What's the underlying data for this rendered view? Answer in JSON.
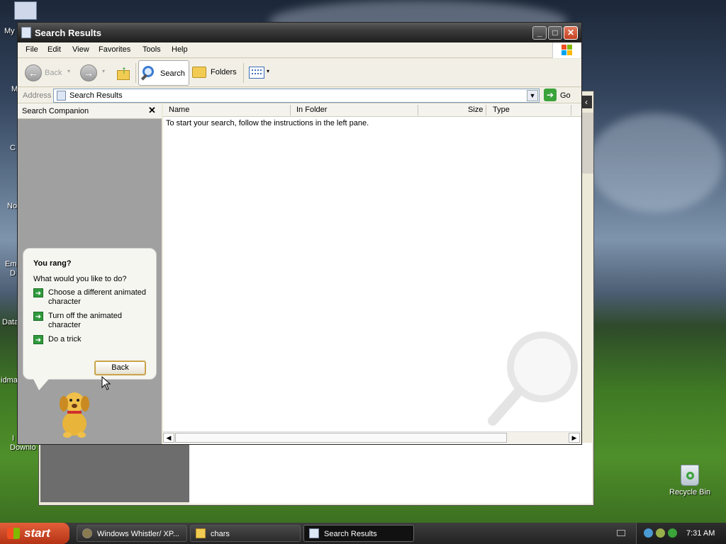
{
  "desktop": {
    "icons": [
      {
        "label": "My"
      },
      {
        "label": "M"
      },
      {
        "label": "C"
      },
      {
        "label": "No"
      },
      {
        "label": "Em"
      },
      {
        "label": "D"
      },
      {
        "label": "Data"
      },
      {
        "label": "idma"
      },
      {
        "label": "I"
      },
      {
        "label": "Downlo"
      }
    ],
    "recycle_bin": "Recycle Bin"
  },
  "window": {
    "title": "Search Results",
    "buttons": {
      "minimize": "_",
      "maximize": "□",
      "close": "✕"
    }
  },
  "menu": {
    "items": [
      "File",
      "Edit",
      "View",
      "Favorites",
      "Tools",
      "Help"
    ]
  },
  "toolbar": {
    "back": "Back",
    "search": "Search",
    "folders": "Folders"
  },
  "address": {
    "label": "Address",
    "value": "Search Results",
    "go": "Go"
  },
  "left_pane": {
    "title": "Search Companion",
    "close": "✕"
  },
  "bubble": {
    "title": "You rang?",
    "question": "What would you like to do?",
    "options": [
      {
        "line1": "Choose a different animated",
        "line2": "character"
      },
      {
        "line1": "Turn off the animated",
        "line2": "character"
      },
      {
        "line1": "Do a trick",
        "line2": ""
      }
    ],
    "back_button": "Back"
  },
  "results": {
    "columns": [
      "Name",
      "In Folder",
      "Size",
      "Type"
    ],
    "instructions": "To start your search, follow the instructions in the left pane."
  },
  "taskbar": {
    "start": "start",
    "items": [
      {
        "label": "Windows Whistler/ XP..."
      },
      {
        "label": "chars"
      },
      {
        "label": "Search Results"
      }
    ],
    "clock": "7:31 AM"
  }
}
